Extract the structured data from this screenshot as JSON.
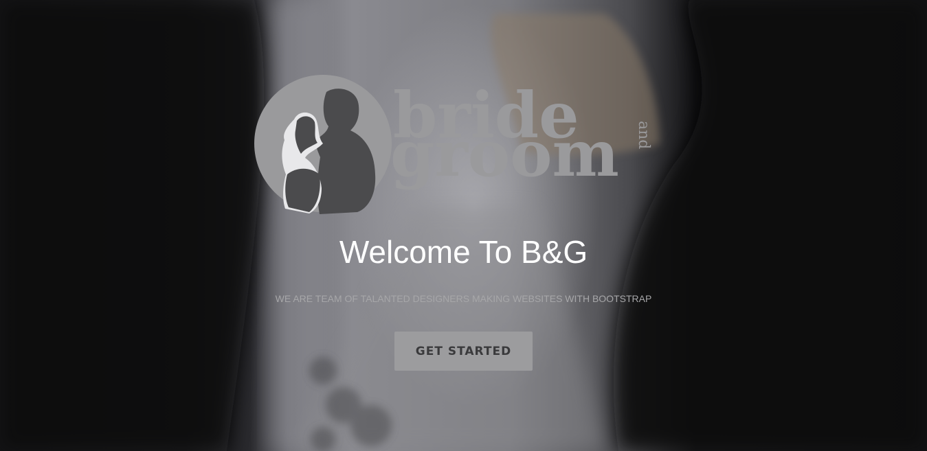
{
  "logo": {
    "line1": "bride",
    "and": "and",
    "line2": "groom"
  },
  "hero": {
    "title": "Welcome To B&G",
    "subtitle": "WE ARE TEAM OF TALANTED DESIGNERS MAKING WEBSITES WITH BOOTSTRAP",
    "cta_label": "GET STARTED"
  },
  "colors": {
    "logo_gray": "#9a9a9c",
    "silhouette": "#4b4b4d",
    "button_bg": "#9c9c9e",
    "button_text": "#3a3a3c",
    "title_text": "#ffffff",
    "subtitle_text": "#a7a7a9"
  }
}
